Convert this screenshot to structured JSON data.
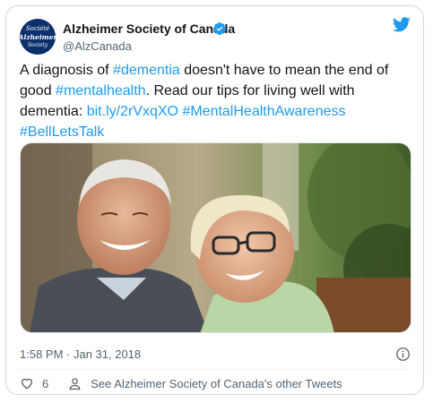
{
  "account": {
    "display_name": "Alzheimer Society of Canada",
    "handle": "@AlzCanada",
    "avatar_lines": [
      "Société",
      "Alzheimer",
      "Society"
    ]
  },
  "tweet": {
    "segments": [
      {
        "text": "A diagnosis of ",
        "link": false
      },
      {
        "text": "#dementia",
        "link": true
      },
      {
        "text": " doesn't have to mean the end of good ",
        "link": false
      },
      {
        "text": "#mentalhealth",
        "link": true
      },
      {
        "text": ". Read our tips for living well with dementia: ",
        "link": false
      },
      {
        "text": "bit.ly/2rVxqXO",
        "link": true
      },
      {
        "text": " ",
        "link": false
      },
      {
        "text": "#MentalHealthAwareness",
        "link": true
      },
      {
        "text": " ",
        "link": false
      },
      {
        "text": "#BellLetsTalk",
        "link": true
      }
    ],
    "timestamp": "1:58 PM · Jan 31, 2018"
  },
  "media": {
    "description_icon": "photo-of-smiling-elderly-couple"
  },
  "footer": {
    "like_count": "6",
    "see_more": "See Alzheimer Society of Canada's other Tweets"
  },
  "colors": {
    "link": "#1d9bf0",
    "secondary_text": "#536471",
    "verified": "#1d9bf0",
    "avatar_bg": "#0b2f6b"
  },
  "icons": [
    "verified-badge-icon",
    "twitter-bird-icon",
    "info-icon",
    "heart-icon",
    "person-icon"
  ]
}
